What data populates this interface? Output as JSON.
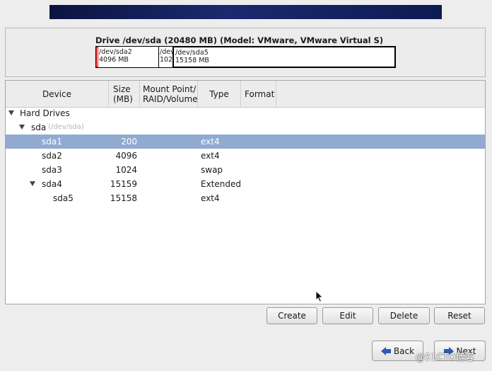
{
  "drive": {
    "title": "Drive /dev/sda (20480 MB) (Model: VMware, VMware Virtual S)",
    "map": {
      "seg1": "",
      "seg2_line1": "/dev/sda2",
      "seg2_line2": "4096 MB",
      "seg3_line1": "/dev",
      "seg3_line2": "102",
      "seg4_line1": "/dev/sda5",
      "seg4_line2": "15158 MB"
    }
  },
  "columns": {
    "device": "Device",
    "size_line1": "Size",
    "size_line2": "(MB)",
    "mount_line1": "Mount Point/",
    "mount_line2": "RAID/Volume",
    "type": "Type",
    "format": "Format"
  },
  "tree": {
    "group": "Hard Drives",
    "disk": "sda",
    "disk_path": "(/dev/sda)",
    "rows": [
      {
        "device": "sda1",
        "size": "200",
        "type": "ext4"
      },
      {
        "device": "sda2",
        "size": "4096",
        "type": "ext4"
      },
      {
        "device": "sda3",
        "size": "1024",
        "type": "swap"
      },
      {
        "device": "sda4",
        "size": "15159",
        "type": "Extended"
      },
      {
        "device": "sda5",
        "size": "15158",
        "type": "ext4"
      }
    ]
  },
  "actions": {
    "create": "Create",
    "edit": "Edit",
    "delete": "Delete",
    "reset": "Reset"
  },
  "nav": {
    "back": "Back",
    "next": "Next"
  },
  "watermark": "@51CTO博客",
  "colors": {
    "selected_row": "#90aad0",
    "banner": "#0b1340",
    "nav_arrow": "#2a5bb5"
  }
}
